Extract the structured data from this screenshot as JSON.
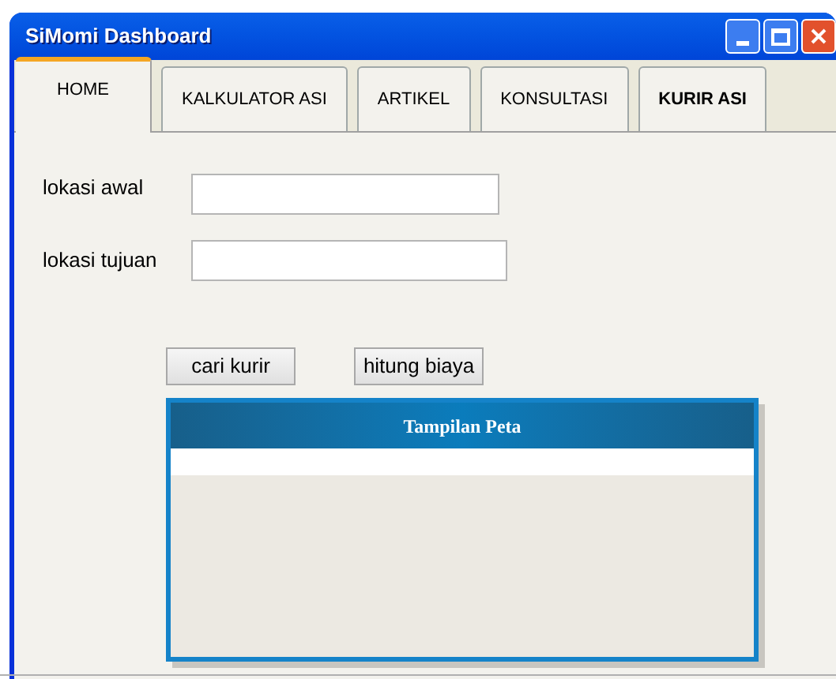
{
  "window": {
    "title": "SiMomi Dashboard"
  },
  "tabs": [
    {
      "label": "HOME",
      "selected": true,
      "bold": false
    },
    {
      "label": "KALKULATOR ASI",
      "selected": false,
      "bold": false
    },
    {
      "label": "ARTIKEL",
      "selected": false,
      "bold": false
    },
    {
      "label": "KONSULTASI",
      "selected": false,
      "bold": false
    },
    {
      "label": "KURIR ASI",
      "selected": false,
      "bold": true
    }
  ],
  "form": {
    "fields": [
      {
        "label": "lokasi awal"
      },
      {
        "label": "lokasi tujuan"
      }
    ],
    "buttons": [
      "cari kurir",
      "hitung biaya"
    ]
  },
  "map_panel": {
    "title": "Tampilan Peta"
  }
}
